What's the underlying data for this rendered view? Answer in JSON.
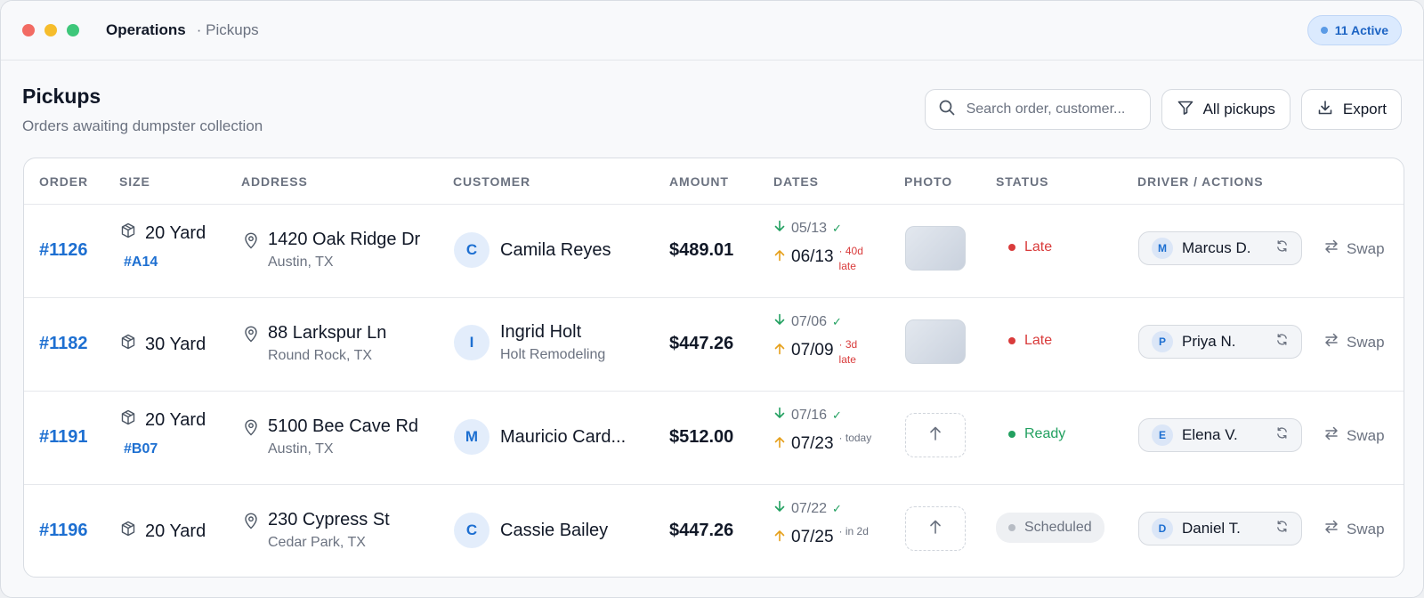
{
  "window": {
    "app": "Operations",
    "crumb": "· Pickups",
    "active_badge": "11 Active"
  },
  "colors": {
    "red_dot": "#f26b63",
    "yellow_dot": "#f6bd2c",
    "green_dot": "#3ec77a",
    "accent": "#1d6fd1",
    "late": "#d93b3b",
    "ready": "#22a060"
  },
  "page": {
    "title": "Pickups",
    "subtitle": "Orders awaiting dumpster collection"
  },
  "toolbar": {
    "search_placeholder": "Search order, customer...",
    "filter_label": "All pickups",
    "export_label": "Export"
  },
  "columns": [
    "ORDER",
    "SIZE",
    "ADDRESS",
    "CUSTOMER",
    "AMOUNT",
    "DATES",
    "PHOTO",
    "STATUS",
    "DRIVER / ACTIONS"
  ],
  "rows": [
    {
      "order": "#1126",
      "size": "20 Yard",
      "tag": "#A14",
      "address1": "1420 Oak Ridge Dr",
      "address2": "Austin, TX",
      "initial": "C",
      "customer": "Camila Reyes",
      "company": "",
      "amount": "$489.01",
      "date1": "05/13",
      "date2": "06/13",
      "note": "· 40d late",
      "note_color": "#d93b3b",
      "photo": "image",
      "status": "Late",
      "status_style": "late",
      "driver_initial": "M",
      "driver": "Marcus D.",
      "action": "Swap"
    },
    {
      "order": "#1182",
      "size": "30 Yard",
      "tag": "",
      "address1": "88 Larkspur Ln",
      "address2": "Round Rock, TX",
      "initial": "I",
      "customer": "Ingrid Holt",
      "company": "Holt Remodeling",
      "amount": "$447.26",
      "date1": "07/06",
      "date2": "07/09",
      "note": "· 3d late",
      "note_color": "#d93b3b",
      "photo": "image",
      "status": "Late",
      "status_style": "late",
      "driver_initial": "P",
      "driver": "Priya N.",
      "action": "Swap"
    },
    {
      "order": "#1191",
      "size": "20 Yard",
      "tag": "#B07",
      "address1": "5100 Bee Cave Rd",
      "address2": "Austin, TX",
      "initial": "M",
      "customer": "Mauricio Card...",
      "company": "",
      "amount": "$512.00",
      "date1": "07/16",
      "date2": "07/23",
      "note": "· today",
      "note_color": "#6b7280",
      "photo": "upload",
      "status": "Ready",
      "status_style": "ready",
      "driver_initial": "E",
      "driver": "Elena V.",
      "action": "Swap"
    },
    {
      "order": "#1196",
      "size": "20 Yard",
      "tag": "",
      "address1": "230 Cypress St",
      "address2": "Cedar Park, TX",
      "initial": "C",
      "customer": "Cassie Bailey",
      "company": "",
      "amount": "$447.26",
      "date1": "07/22",
      "date2": "07/25",
      "note": "· in 2d",
      "note_color": "#6b7280",
      "photo": "upload",
      "status": "Scheduled",
      "status_style": "scheduled",
      "driver_initial": "D",
      "driver": "Daniel T.",
      "action": "Swap"
    }
  ]
}
